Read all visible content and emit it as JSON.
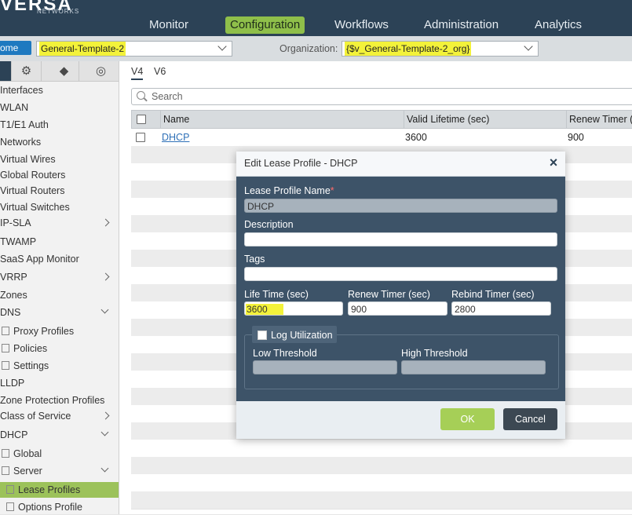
{
  "app": {
    "logo": "VERSA",
    "logo_sub": "NETWORKS"
  },
  "nav": {
    "items": [
      "Monitor",
      "Configuration",
      "Workflows",
      "Administration",
      "Analytics"
    ],
    "active": "Configuration"
  },
  "subbar": {
    "home_label": "ome",
    "template_value": "General-Template-2",
    "org_label": "Organization:",
    "org_value": "{$v_General-Template-2_org}"
  },
  "sidebar": {
    "items": [
      "Interfaces",
      "WLAN",
      "T1/E1 Auth",
      "Networks",
      "Virtual Wires",
      "Global Routers",
      "Virtual Routers",
      "Virtual Switches",
      "IP-SLA",
      "TWAMP",
      "SaaS App Monitor",
      "VRRP",
      "Zones",
      "DNS",
      "Proxy Profiles",
      "Policies",
      "Settings",
      "LLDP",
      "Zone Protection Profiles",
      "Class of Service",
      "DHCP",
      "Global",
      "Server",
      "Lease Profiles",
      "Options Profile"
    ]
  },
  "main": {
    "tabs": [
      "V4",
      "V6"
    ],
    "search_placeholder": "Search",
    "columns": [
      "Name",
      "Valid Lifetime (sec)",
      "Renew Timer (s"
    ],
    "rows": [
      {
        "name": "DHCP",
        "valid_lifetime": "3600",
        "renew_timer": "900"
      }
    ]
  },
  "modal": {
    "title": "Edit Lease Profile - DHCP",
    "fields": {
      "name_label": "Lease Profile Name",
      "name_value": "DHCP",
      "desc_label": "Description",
      "tags_label": "Tags",
      "life_label": "Life Time (sec)",
      "life_value": "3600",
      "renew_label": "Renew Timer (sec)",
      "renew_value": "900",
      "rebind_label": "Rebind Timer (sec)",
      "rebind_value": "2800",
      "log_label": "Log Utilization",
      "low_label": "Low Threshold",
      "high_label": "High Threshold"
    },
    "ok_label": "OK",
    "cancel_label": "Cancel"
  },
  "colors": {
    "header": "#2c4256",
    "accent_green": "#8fbf4a",
    "highlight": "#f3f23a",
    "ok": "#a6cf57"
  }
}
